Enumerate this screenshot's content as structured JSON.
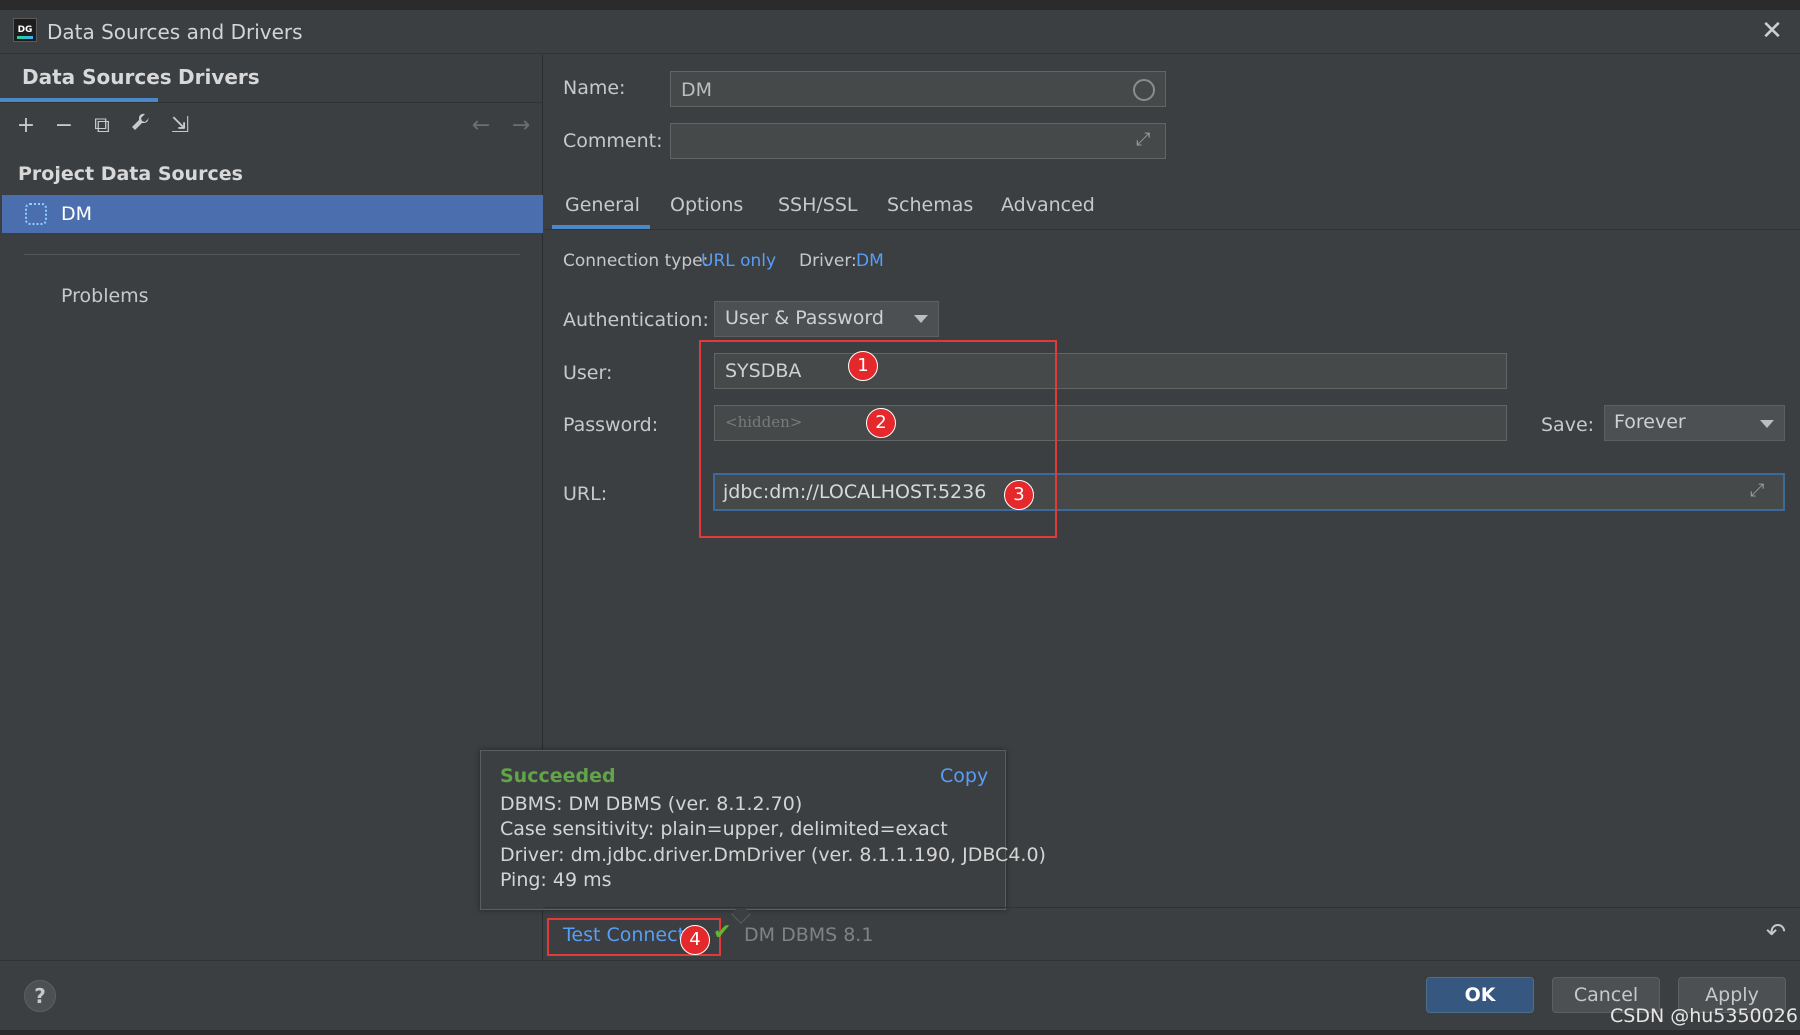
{
  "window": {
    "title": "Data Sources and Drivers",
    "app_icon_text": "DG"
  },
  "left_tabs": {
    "data_sources": "Data Sources",
    "drivers": "Drivers"
  },
  "toolbar": {
    "add": "+",
    "remove": "−",
    "duplicate": "⧉",
    "properties": "🔧",
    "import": "⇲",
    "back": "←",
    "forward": "→"
  },
  "sidebar": {
    "section_header": "Project Data Sources",
    "selected_item": "DM",
    "problems": "Problems"
  },
  "form": {
    "name_label": "Name:",
    "name_value": "DM",
    "comment_label": "Comment:",
    "comment_value": ""
  },
  "tabs": [
    "General",
    "Options",
    "SSH/SSL",
    "Schemas",
    "Advanced"
  ],
  "connection": {
    "type_label": "Connection type:",
    "type_value": "URL only",
    "driver_label": "Driver:",
    "driver_value": "DM"
  },
  "auth": {
    "label": "Authentication:",
    "value": "User & Password",
    "user_label": "User:",
    "user_value": "SYSDBA",
    "password_label": "Password:",
    "password_placeholder": "<hidden>",
    "save_label": "Save:",
    "save_value": "Forever",
    "url_label": "URL:",
    "url_value": "jdbc:dm://LOCALHOST:5236"
  },
  "badges": [
    "1",
    "2",
    "3",
    "4"
  ],
  "popup": {
    "status": "Succeeded",
    "copy": "Copy",
    "lines": [
      "DBMS: DM DBMS (ver. 8.1.2.70)",
      "Case sensitivity: plain=upper, delimited=exact",
      "Driver: dm.jdbc.driver.DmDriver (ver. 8.1.1.190, JDBC4.0)",
      "Ping: 49 ms"
    ]
  },
  "bottom": {
    "test_connection": "Test Connecti",
    "dbms_version": "DM DBMS 8.1"
  },
  "buttons": {
    "help": "?",
    "ok": "OK",
    "cancel": "Cancel",
    "apply": "Apply"
  },
  "watermark": "CSDN @hu5350026",
  "colors": {
    "accent": "#4a88c7",
    "link": "#589df6",
    "success": "#62a44a",
    "annotation": "#e03a3a"
  }
}
